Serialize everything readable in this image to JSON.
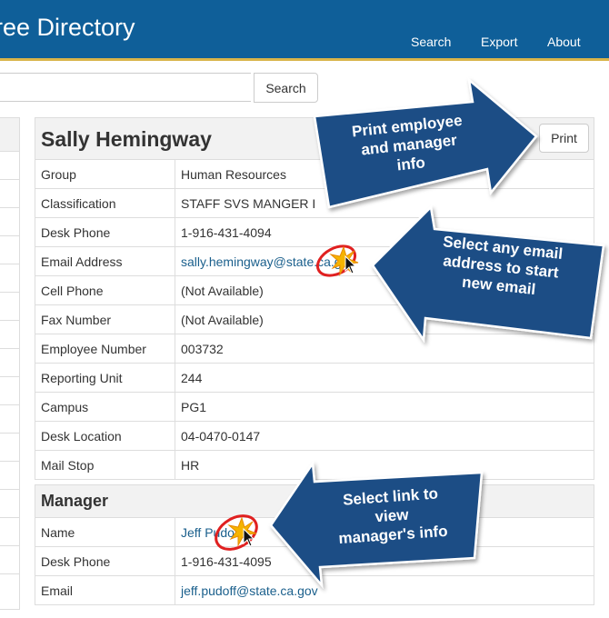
{
  "header": {
    "title": "ree Directory",
    "nav": [
      {
        "label": "Search"
      },
      {
        "label": "Export"
      },
      {
        "label": "About"
      }
    ]
  },
  "search": {
    "value": "",
    "button_label": "Search"
  },
  "employee": {
    "name": "Sally Hemingway",
    "print_label": "Print",
    "fields": [
      {
        "label": "Group",
        "value": "Human Resources"
      },
      {
        "label": "Classification",
        "value": "STAFF SVS MANGER I"
      },
      {
        "label": "Desk Phone",
        "value": "1-916-431-4094"
      },
      {
        "label": "Email Address",
        "value": "sally.hemingway@state.ca.gov"
      },
      {
        "label": "Cell Phone",
        "value": "(Not Available)"
      },
      {
        "label": "Fax Number",
        "value": "(Not Available)"
      },
      {
        "label": "Employee Number",
        "value": "003732"
      },
      {
        "label": "Reporting Unit",
        "value": "244"
      },
      {
        "label": "Campus",
        "value": "PG1"
      },
      {
        "label": "Desk Location",
        "value": "04-0470-0147"
      },
      {
        "label": "Mail Stop",
        "value": "HR"
      }
    ]
  },
  "manager": {
    "heading": "Manager",
    "fields": [
      {
        "label": "Name",
        "value": "Jeff Pudoff"
      },
      {
        "label": "Desk Phone",
        "value": "1-916-431-4095"
      },
      {
        "label": "Email",
        "value": "jeff.pudoff@state.ca.gov"
      }
    ]
  },
  "callouts": {
    "print": "Print employee\nand manager\ninfo",
    "email": "Select any email\naddress to start\nnew email",
    "manager": "Select link to\nview\nmanager's info"
  },
  "colors": {
    "header": "#0f5f99",
    "accent_line": "#d9b44a",
    "callout_fill": "#1f4e85",
    "link": "#1a5f8c",
    "click_ring": "#e02020"
  }
}
